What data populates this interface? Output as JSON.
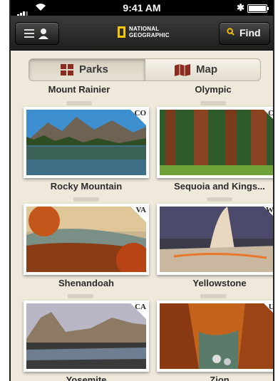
{
  "status_bar": {
    "time": "9:41 AM"
  },
  "navbar": {
    "logo_text": "NATIONAL\nGEOGRAPHIC",
    "find_label": "Find"
  },
  "tabs": [
    {
      "label": "Parks",
      "active": true
    },
    {
      "label": "Map",
      "active": false
    }
  ],
  "previous_row": [
    "Mount Rainier",
    "Olympic"
  ],
  "parks": [
    {
      "name": "Rocky Mountain",
      "state": "CO"
    },
    {
      "name": "Sequoia and Kings...",
      "state": "CA"
    },
    {
      "name": "Shenandoah",
      "state": "VA"
    },
    {
      "name": "Yellowstone",
      "state": "WY"
    },
    {
      "name": "Yosemite",
      "state": "CA"
    },
    {
      "name": "Zion",
      "state": "UT"
    }
  ],
  "colors": {
    "accent": "#f7c500",
    "background": "#efe9dc"
  }
}
